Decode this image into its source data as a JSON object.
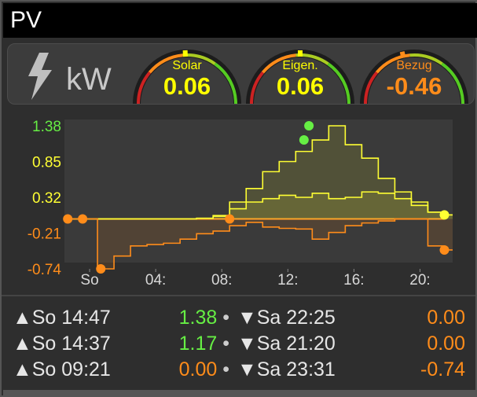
{
  "title": "PV",
  "header": {
    "unit": "kW",
    "icon": "lightning-bolt-icon"
  },
  "gauges": [
    {
      "label": "Solar",
      "value": "0.06",
      "color": "#ffff00"
    },
    {
      "label": "Eigen.",
      "value": "0.06",
      "color": "#ffff00"
    },
    {
      "label": "Bezug",
      "value": "-0.46",
      "color": "#ff8c1a"
    }
  ],
  "chart_data": {
    "type": "line",
    "y_ticks": [
      "1.38",
      "0.85",
      "0.32",
      "-0.21",
      "-0.74"
    ],
    "y_tick_colors": [
      "#66ee44",
      "#ffff33",
      "#ffff33",
      "#ff8c1a",
      "#ff8c1a"
    ],
    "x_ticks": [
      "So",
      "04:",
      "08:",
      "12:",
      "16:",
      "20:"
    ],
    "ylim": [
      -0.74,
      1.38
    ],
    "series": [
      {
        "color": "#ffff33",
        "x": [
          0,
          1,
          2,
          3,
          4,
          5,
          6,
          7,
          8,
          9,
          10,
          11,
          12,
          13,
          14,
          15,
          16,
          17,
          18,
          19,
          20,
          21,
          22,
          23
        ],
        "values": [
          0,
          0,
          0,
          0,
          0,
          0,
          0,
          0,
          0.01,
          0.05,
          0.25,
          0.45,
          0.7,
          0.85,
          1.0,
          1.17,
          1.38,
          1.1,
          0.9,
          0.6,
          0.4,
          0.25,
          0.1,
          0.06
        ]
      },
      {
        "color": "#ffff33",
        "x": [
          0,
          1,
          2,
          3,
          4,
          5,
          6,
          7,
          8,
          9,
          10,
          11,
          12,
          13,
          14,
          15,
          16,
          17,
          18,
          19,
          20,
          21,
          22,
          23
        ],
        "values": [
          0,
          0,
          0,
          0,
          0,
          0,
          0,
          0,
          0.01,
          0.04,
          0.15,
          0.25,
          0.3,
          0.35,
          0.32,
          0.38,
          0.3,
          0.32,
          0.4,
          0.38,
          0.3,
          0.2,
          0.1,
          0.06
        ]
      },
      {
        "color": "#ff8c1a",
        "x": [
          0,
          1,
          2,
          3,
          4,
          5,
          6,
          7,
          8,
          9,
          10,
          11,
          12,
          13,
          14,
          15,
          16,
          17,
          18,
          19,
          20,
          21,
          22,
          23
        ],
        "values": [
          0,
          0,
          -0.74,
          -0.55,
          -0.4,
          -0.38,
          -0.36,
          -0.3,
          -0.22,
          -0.18,
          -0.1,
          -0.05,
          -0.12,
          -0.14,
          -0.15,
          -0.3,
          -0.2,
          -0.1,
          -0.06,
          -0.03,
          0,
          0,
          -0.4,
          -0.46
        ]
      }
    ],
    "markers": [
      {
        "x": 0.2,
        "y": 0,
        "color": "#ff8c1a"
      },
      {
        "x": 1.1,
        "y": 0,
        "color": "#ff8c1a"
      },
      {
        "x": 2.2,
        "y": -0.74,
        "color": "#ff8c1a"
      },
      {
        "x": 10.0,
        "y": 0,
        "color": "#ff8c1a"
      },
      {
        "x": 14.5,
        "y": 1.17,
        "color": "#66ee44"
      },
      {
        "x": 14.8,
        "y": 1.38,
        "color": "#66ee44"
      },
      {
        "x": 23.0,
        "y": 0.06,
        "color": "#ffff33"
      },
      {
        "x": 23.0,
        "y": -0.46,
        "color": "#ff8c1a"
      }
    ],
    "grid": false
  },
  "stats": [
    {
      "up_label": "So 14:47",
      "up_value": "1.38",
      "up_color": "#66ee44",
      "down_label": "Sa 22:25",
      "down_value": "0.00",
      "down_color": "#ff8c1a"
    },
    {
      "up_label": "So 14:37",
      "up_value": "1.17",
      "up_color": "#66ee44",
      "down_label": "Sa 21:20",
      "down_value": "0.00",
      "down_color": "#ff8c1a"
    },
    {
      "up_label": "So 09:21",
      "up_value": "0.00",
      "up_color": "#ff8c1a",
      "down_label": "Sa 23:31",
      "down_value": "-0.74",
      "down_color": "#ff8c1a"
    }
  ],
  "symbols": {
    "up": "▲",
    "down": "▼",
    "dot": "•"
  }
}
